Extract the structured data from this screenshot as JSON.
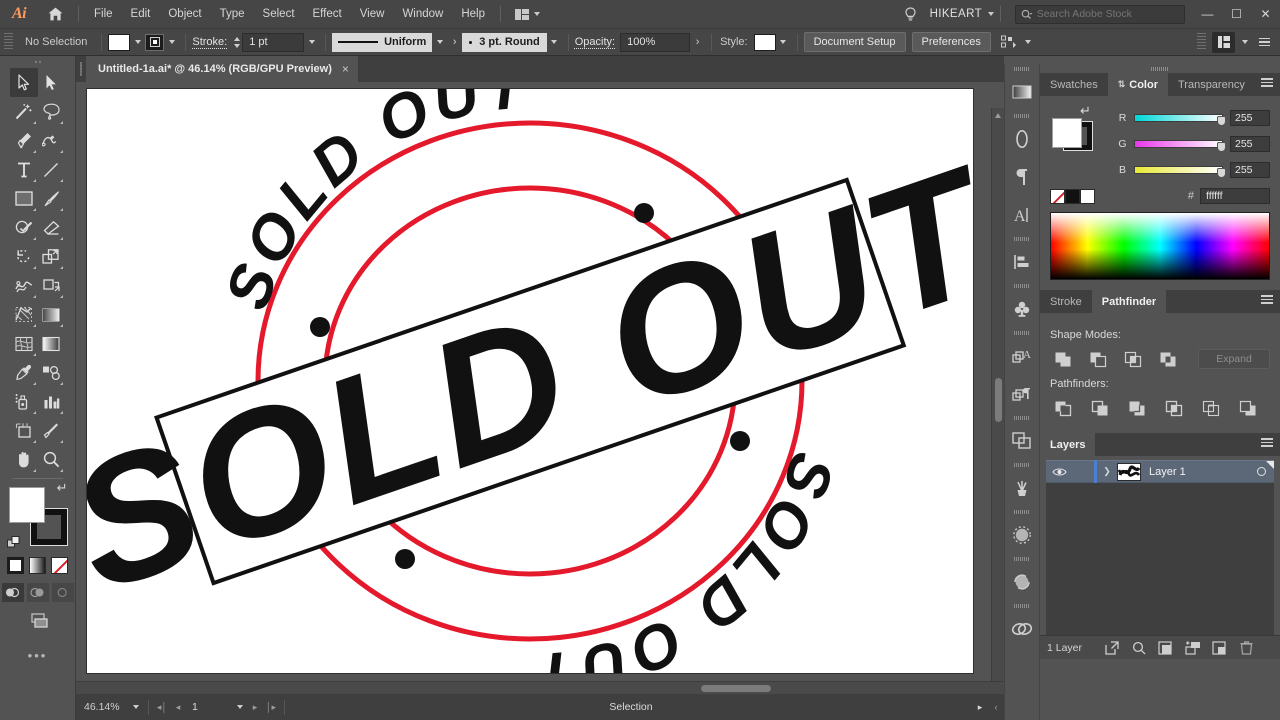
{
  "app": {
    "name": "Ai",
    "logo_text": "Ai"
  },
  "menubar": {
    "items": [
      "File",
      "Edit",
      "Object",
      "Type",
      "Select",
      "Effect",
      "View",
      "Window",
      "Help"
    ],
    "user": "HIKEART",
    "search_placeholder": "Search Adobe Stock",
    "window_buttons": {
      "minimize": "—",
      "maximize": "☐",
      "close": "✕"
    }
  },
  "controlbar": {
    "selection_status": "No Selection",
    "stroke_label": "Stroke:",
    "stroke_weight": "1 pt",
    "stroke_profile": "Uniform",
    "brush_definition": "3 pt. Round",
    "opacity_label": "Opacity:",
    "opacity_value": "100%",
    "style_label": "Style:",
    "document_setup": "Document Setup",
    "preferences": "Preferences"
  },
  "document": {
    "tab_title": "Untitled-1a.ai* @ 46.14% (RGB/GPU Preview)",
    "close_glyph": "×"
  },
  "statusbar": {
    "zoom": "46.14%",
    "page": "1",
    "tool": "Selection"
  },
  "toolbar": {
    "tools": [
      "selection-tool",
      "direct-selection-tool",
      "magic-wand-tool",
      "lasso-tool",
      "pen-tool",
      "curvature-tool",
      "type-tool",
      "line-segment-tool",
      "rectangle-tool",
      "paintbrush-tool",
      "shaper-tool",
      "eraser-tool",
      "rotate-tool",
      "scale-tool",
      "width-tool",
      "free-transform-tool",
      "shape-builder-tool",
      "perspective-grid-tool",
      "mesh-tool",
      "gradient-tool",
      "eyedropper-tool",
      "blend-tool",
      "symbol-sprayer-tool",
      "column-graph-tool",
      "artboard-tool",
      "slice-tool",
      "hand-tool",
      "zoom-tool"
    ],
    "fill_color": "#ffffff",
    "stroke_color": "#111111",
    "color_modes": [
      "color",
      "gradient",
      "none"
    ],
    "draw_modes": [
      "draw-normal",
      "draw-behind",
      "draw-inside"
    ],
    "more_tools": "•••"
  },
  "icon_dock": {
    "icons": [
      "gradient-panel-icon",
      "brushes-panel-icon",
      "paragraph-panel-icon",
      "character-panel-icon",
      "align-panel-icon",
      "symbols-panel-icon",
      "graphic-styles-panel-icon",
      "appearance-panel-icon",
      "pathfinder-dock-icon",
      "libraries-panel-icon",
      "image-trace-panel-icon",
      "recolor-artwork-icon",
      "links-panel-icon"
    ]
  },
  "panels": {
    "color_group": {
      "tabs": [
        {
          "label": "Swatches",
          "active": false
        },
        {
          "label": "Color",
          "active": true
        },
        {
          "label": "Transparency",
          "active": false
        }
      ],
      "sliders": [
        {
          "label": "R",
          "value": "255"
        },
        {
          "label": "G",
          "value": "255"
        },
        {
          "label": "B",
          "value": "255"
        }
      ],
      "hash": "#",
      "hex": "ffffff"
    },
    "pathfinder_group": {
      "tabs": [
        {
          "label": "Stroke",
          "active": false
        },
        {
          "label": "Pathfinder",
          "active": true
        }
      ],
      "shape_modes_label": "Shape Modes:",
      "shape_modes": [
        "unite",
        "minus-front",
        "intersect",
        "exclude"
      ],
      "expand_label": "Expand",
      "pathfinders_label": "Pathfinders:",
      "pathfinders": [
        "divide",
        "trim",
        "merge",
        "crop",
        "outline",
        "minus-back"
      ]
    },
    "layers_group": {
      "tabs": [
        {
          "label": "Layers",
          "active": true
        }
      ],
      "rows": [
        {
          "name": "Layer 1",
          "visible": true,
          "selected": true
        }
      ],
      "footer_count": "1 Layer",
      "footer_icons": [
        "locate-object-icon",
        "make-clipping-mask-icon",
        "create-new-sublayer-icon",
        "create-new-layer-icon",
        "delete-selection-icon"
      ]
    }
  },
  "artwork": {
    "name": "sold-out-stamp",
    "outer_circle_color": "#e4192b",
    "inner_circle_color": "#e4192b",
    "text_color": "#111111",
    "banner_fill": "#ffffff",
    "banner_stroke": "#111111",
    "banner_text": "SOLD OUT",
    "arc_text_top": "SOLD OUT",
    "arc_text_bottom": "SOLD OUT",
    "dot_count": 4
  }
}
